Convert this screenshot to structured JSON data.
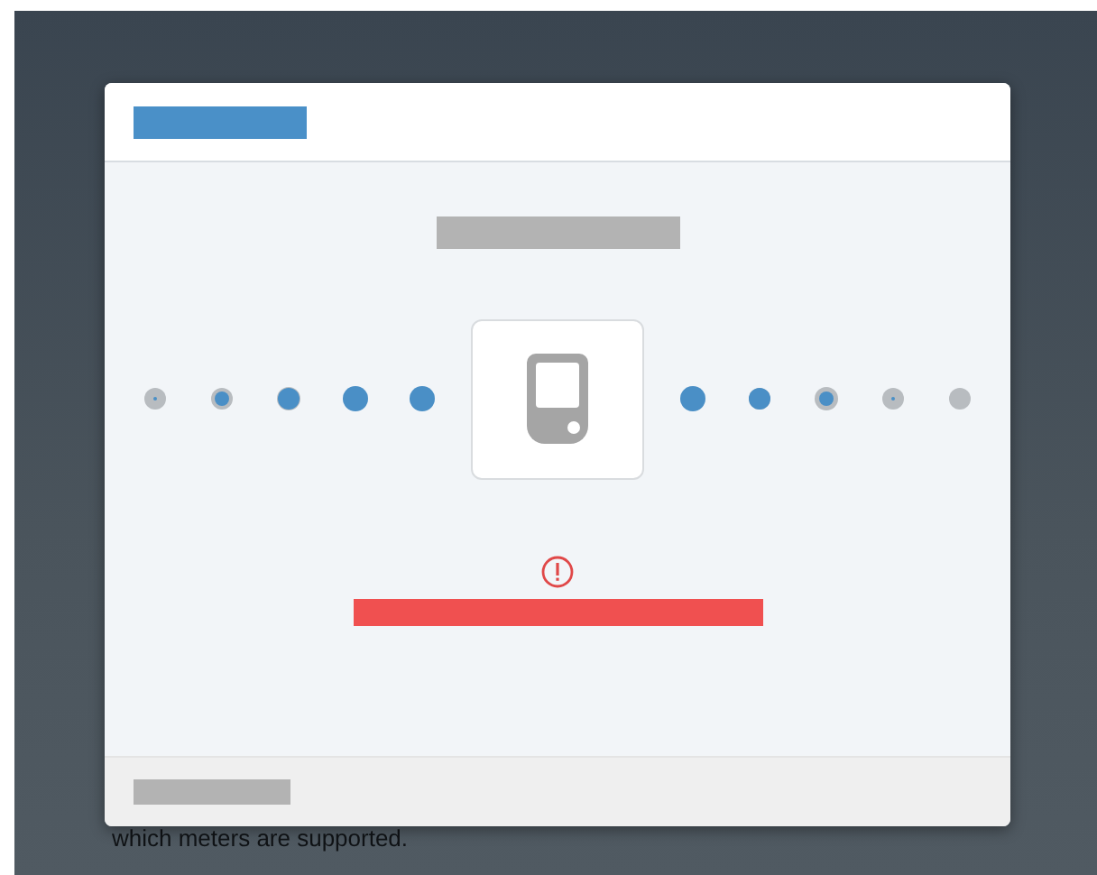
{
  "background": {
    "note": "which meters are supported."
  },
  "dialog": {
    "status": {
      "kind": "error"
    }
  }
}
